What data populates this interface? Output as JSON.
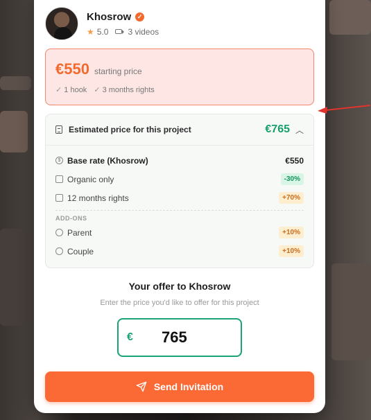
{
  "creator": {
    "name": "Khosrow",
    "rating": "5.0",
    "videos": "3 videos"
  },
  "pricing": {
    "starting_price": "€550",
    "starting_label": "starting price",
    "includes": [
      "1 hook",
      "3 months rights"
    ]
  },
  "estimate": {
    "title": "Estimated price for this project",
    "total": "€765",
    "rows": [
      {
        "label": "Base rate (Khosrow)",
        "value": "€550",
        "type": "base",
        "icon": "dollar-icon"
      },
      {
        "label": "Organic only",
        "value": "-30%",
        "type": "green",
        "icon": "megaphone-icon"
      },
      {
        "label": "12 months rights",
        "value": "+70%",
        "type": "orange",
        "icon": "document-icon"
      }
    ],
    "addons_label": "ADD-ONS",
    "addons": [
      {
        "label": "Parent",
        "value": "+10%",
        "icon": "person-icon"
      },
      {
        "label": "Couple",
        "value": "+10%",
        "icon": "person-icon"
      }
    ]
  },
  "offer": {
    "title": "Your offer to Khosrow",
    "subtitle": "Enter the price you'd like to offer for this project",
    "currency": "€",
    "amount": "765"
  },
  "send_button": "Send Invitation",
  "colors": {
    "accent": "#fb6a35",
    "green": "#169f6b"
  }
}
